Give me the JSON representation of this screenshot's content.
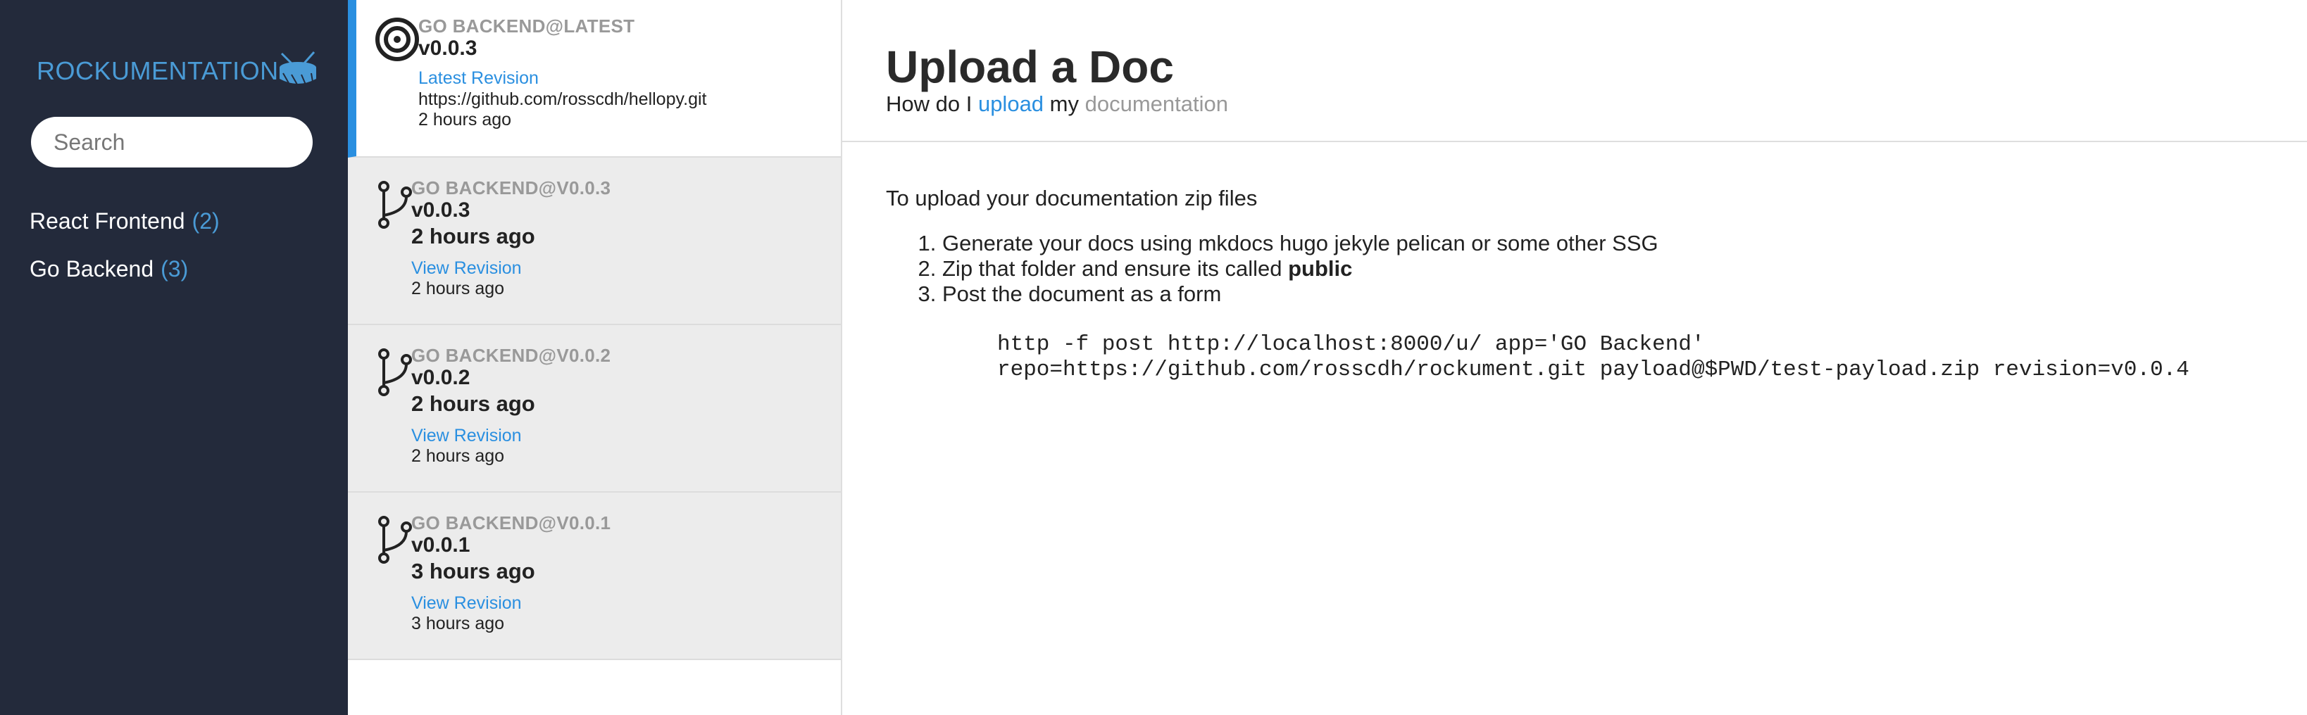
{
  "sidebar": {
    "brand": "ROCKUMENTATION",
    "brand_icon": "drum-icon",
    "search_placeholder": "Search",
    "projects": [
      {
        "name": "React Frontend",
        "count": "(2)"
      },
      {
        "name": "Go Backend",
        "count": "(3)"
      }
    ]
  },
  "revisions": [
    {
      "label": "GO BACKEND@LATEST",
      "version": "v0.0.3",
      "link": "Latest Revision",
      "repo": "https://github.com/rosscdh/hellopy.git",
      "time": "2 hours ago",
      "icon": "target-icon"
    },
    {
      "label": "GO BACKEND@V0.0.3",
      "version": "v0.0.3",
      "time_big": "2 hours ago",
      "link": "View Revision",
      "time": "2 hours ago",
      "icon": "git-branch-icon"
    },
    {
      "label": "GO BACKEND@V0.0.2",
      "version": "v0.0.2",
      "time_big": "2 hours ago",
      "link": "View Revision",
      "time": "2 hours ago",
      "icon": "git-branch-icon"
    },
    {
      "label": "GO BACKEND@V0.0.1",
      "version": "v0.0.1",
      "time_big": "3 hours ago",
      "link": "View Revision",
      "time": "3 hours ago",
      "icon": "git-branch-icon"
    }
  ],
  "main": {
    "title": "Upload a Doc",
    "subtitle": {
      "part1": "How do I ",
      "highlight": "upload",
      "part2": " my ",
      "muted": "documentation"
    },
    "intro": "To upload your documentation zip files",
    "steps": {
      "s1": "Generate your docs using mkdocs hugo jekyle pelican or some other SSG",
      "s2_text": "Zip that folder and ensure its called ",
      "s2_bold": "public",
      "s3": "Post the document as a form"
    },
    "code": {
      "line1": "http -f post http://localhost:8000/u/ app='GO Backend'",
      "line2": "repo=https://github.com/rosscdh/rockument.git payload@$PWD/test-payload.zip revision=v0.0.4"
    }
  },
  "colors": {
    "sidebar_bg": "#232a3b",
    "accent": "#2a8fe0",
    "brand": "#4a9bd6"
  }
}
